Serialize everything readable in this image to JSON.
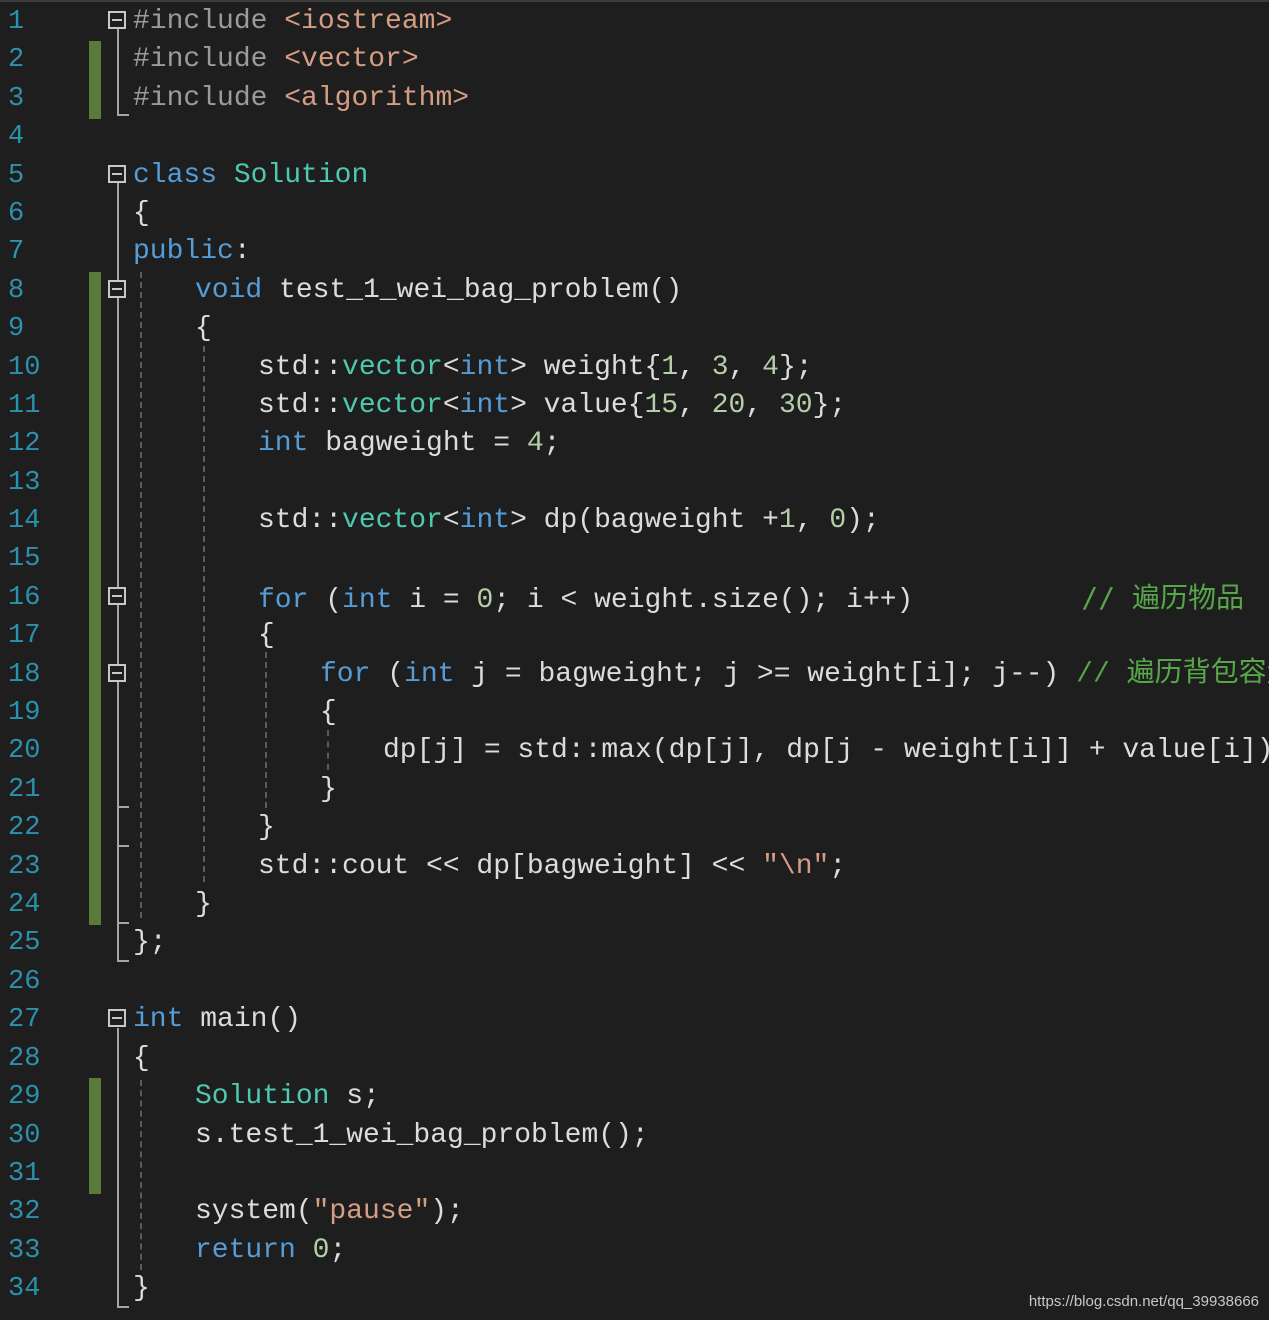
{
  "editor": {
    "line_numbers": [
      "1",
      "2",
      "3",
      "4",
      "5",
      "6",
      "7",
      "8",
      "9",
      "10",
      "11",
      "12",
      "13",
      "14",
      "15",
      "16",
      "17",
      "18",
      "19",
      "20",
      "21",
      "22",
      "23",
      "24",
      "25",
      "26",
      "27",
      "28",
      "29",
      "30",
      "31",
      "32",
      "33",
      "34"
    ],
    "lines": {
      "l1_a": "#include ",
      "l1_b": "<iostream>",
      "l2_a": "#include ",
      "l2_b": "<vector>",
      "l3_a": "#include ",
      "l3_b": "<algorithm>",
      "l5_a": "class ",
      "l5_b": "Solution",
      "l6": "{",
      "l7_a": "public",
      "l7_b": ":",
      "l8_a": "void ",
      "l8_b": "test_1_wei_bag_problem()",
      "l9": "{",
      "l10_a": "std::",
      "l10_b": "vector",
      "l10_c": "<",
      "l10_d": "int",
      "l10_e": "> weight{",
      "l10_f": "1",
      "l10_g": ", ",
      "l10_h": "3",
      "l10_i": ", ",
      "l10_j": "4",
      "l10_k": "};",
      "l11_a": "std::",
      "l11_b": "vector",
      "l11_c": "<",
      "l11_d": "int",
      "l11_e": "> value{",
      "l11_f": "15",
      "l11_g": ", ",
      "l11_h": "20",
      "l11_i": ", ",
      "l11_j": "30",
      "l11_k": "};",
      "l12_a": "int",
      "l12_b": " bagweight = ",
      "l12_c": "4",
      "l12_d": ";",
      "l14_a": "std::",
      "l14_b": "vector",
      "l14_c": "<",
      "l14_d": "int",
      "l14_e": "> dp(bagweight +",
      "l14_f": "1",
      "l14_g": ", ",
      "l14_h": "0",
      "l14_i": ");",
      "l16_a": "for",
      "l16_b": " (",
      "l16_c": "int",
      "l16_d": " i = ",
      "l16_e": "0",
      "l16_f": "; i < weight.size(); i++)          ",
      "l16_g": "// 遍历物品",
      "l17": "{",
      "l18_a": "for",
      "l18_b": " (",
      "l18_c": "int",
      "l18_d": " j = bagweight; j >= weight[i]; j--) ",
      "l18_e": "// 遍历背包容量",
      "l19": "{",
      "l20": "dp[j] = std::max(dp[j], dp[j - weight[i]] + value[i]);",
      "l21": "}",
      "l22": "}",
      "l23_a": "std::cout << dp[bagweight] << ",
      "l23_b": "\"\\n\"",
      "l23_c": ";",
      "l24": "}",
      "l25": "};",
      "l27_a": "int",
      "l27_b": " main()",
      "l28": "{",
      "l29_a": "Solution",
      "l29_b": " s;",
      "l30": "s.test_1_wei_bag_problem();",
      "l32_a": "system(",
      "l32_b": "\"pause\"",
      "l32_c": ");",
      "l33_a": "return",
      "l33_b": " ",
      "l33_c": "0",
      "l33_d": ";",
      "l34": "}"
    }
  },
  "watermark": "https://blog.csdn.net/qq_39938666",
  "colors": {
    "background": "#1e1e1e",
    "line_number": "#2b91af",
    "keyword": "#569cd6",
    "type": "#4ec9b0",
    "string": "#d69d85",
    "comment": "#57a64a",
    "number": "#b5cea8",
    "text": "#dcdcdc",
    "change_bar": "#5a7a3a"
  }
}
